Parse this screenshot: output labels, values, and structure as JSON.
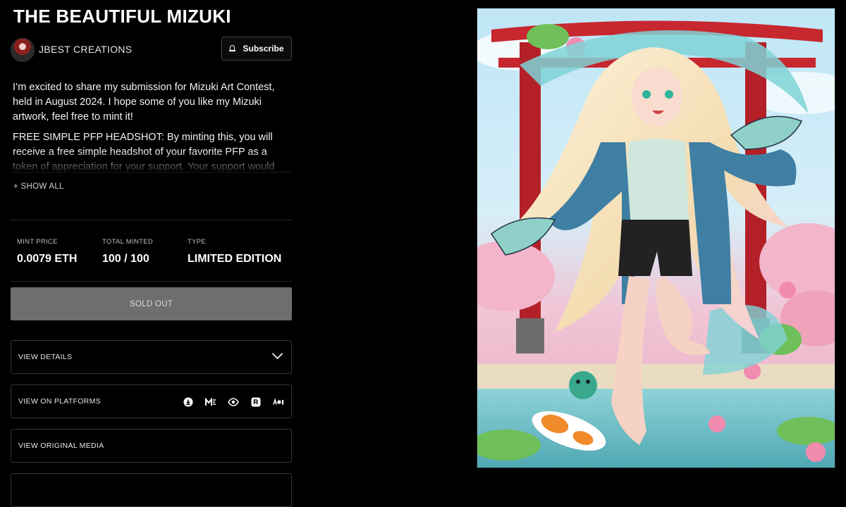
{
  "title": "THE BEAUTIFUL MIZUKI",
  "creator": {
    "name": "JBEST CREATIONS",
    "subscribe_label": "Subscribe"
  },
  "description": {
    "paragraph1": "I’m excited to share my submission for Mizuki Art Contest, held in August 2024. I hope some of you like my Mizuki artwork, feel free to mint it!",
    "paragraph2": "FREE SIMPLE PFP HEADSHOT: By minting this, you will receive a free simple headshot of your favorite PFP as a token of appreciation for your support. Your support would",
    "show_all": "+ SHOW ALL"
  },
  "stats": [
    {
      "label": "MINT PRICE",
      "value": "0.0079 ETH"
    },
    {
      "label": "TOTAL MINTED",
      "value": "100 / 100"
    },
    {
      "label": "TYPE",
      "value": "LIMITED EDITION"
    }
  ],
  "sold_out_label": "SOLD OUT",
  "panels": {
    "details": "VIEW DETAILS",
    "platforms": "VIEW ON PLATFORMS",
    "original_media": "VIEW ORIGINAL MEDIA"
  },
  "platform_icons": [
    "download-icon",
    "magic-eden-icon",
    "eye-icon",
    "rarible-icon",
    "aoi-icon"
  ],
  "colors": {
    "background": "#000000",
    "sold_out_bg": "#6e6e6e",
    "border": "#333333"
  }
}
